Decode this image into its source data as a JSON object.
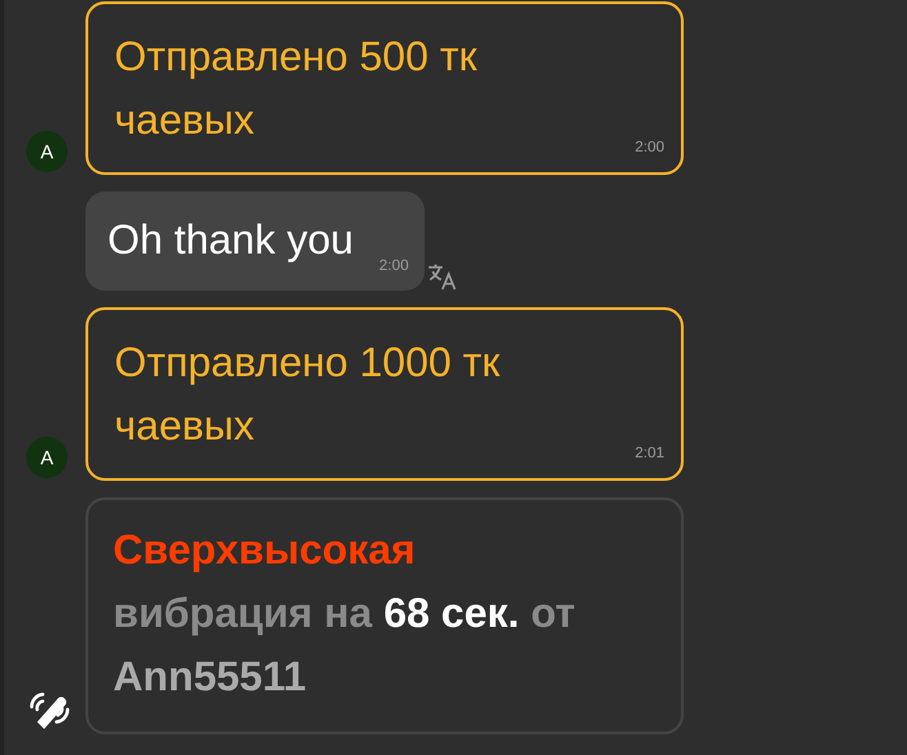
{
  "messages": [
    {
      "kind": "tip",
      "avatar": "A",
      "text": "Отправлено 500 тк чаевых",
      "time": "2:00"
    },
    {
      "kind": "text",
      "text": "Oh thank you",
      "time": "2:00",
      "translatable": true
    },
    {
      "kind": "tip",
      "avatar": "A",
      "text": "Отправлено 1000 тк чаевых",
      "time": "2:01"
    },
    {
      "kind": "vibration",
      "segments": [
        {
          "kind": "level",
          "text": "Сверхвысокая"
        },
        {
          "kind": "plain",
          "text": "вибрация на"
        },
        {
          "kind": "value",
          "text": "68 сек."
        },
        {
          "kind": "plain",
          "text": "от"
        },
        {
          "kind": "user",
          "text": "Ann55511"
        }
      ]
    }
  ]
}
